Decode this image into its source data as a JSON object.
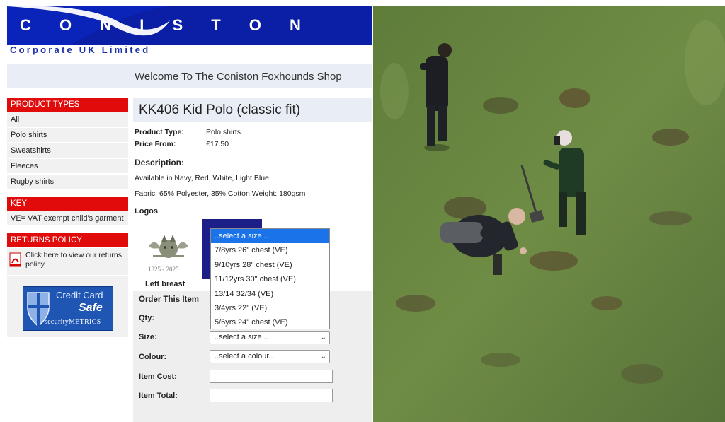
{
  "header": {
    "brand": "C O N I S T O N",
    "tagline": "Corporate UK Limited",
    "welcome": "Welcome To The Coniston Foxhounds Shop"
  },
  "sidebar": {
    "product_types_heading": "PRODUCT TYPES",
    "product_types": [
      "All",
      "Polo shirts",
      "Sweatshirts",
      "Fleeces",
      "Rugby shirts"
    ],
    "key_heading": "KEY",
    "key_text": "VE= VAT exempt child's garment",
    "returns_heading": "RETURNS POLICY",
    "returns_link": "Click here to view our returns policy",
    "credit_card": {
      "line1": "Credit Card",
      "line2": "Safe",
      "line3": "securityMETRICS"
    }
  },
  "product": {
    "title": "KK406 Kid Polo (classic fit)",
    "type_label": "Product Type:",
    "type_value": "Polo shirts",
    "price_label": "Price From:",
    "price_value": "£17.50",
    "description_heading": "Description:",
    "description_line1": "Available in Navy, Red, White, Light Blue",
    "description_line2": "Fabric: 65% Polyester, 35% Cotton Weight: 180gsm",
    "logos_heading": "Logos",
    "logo_years": "1825 - 2025",
    "logo_caption": "Left breast"
  },
  "order": {
    "heading": "Order This Item",
    "qty_label": "Qty:",
    "size_label": "Size:",
    "size_value": "..select a size ..",
    "colour_label": "Colour:",
    "colour_value": "..select a colour..",
    "item_cost_label": "Item Cost:",
    "item_total_label": "Item Total:"
  },
  "size_dropdown": {
    "options": [
      "..select a size ..",
      "7/8yrs 26\" chest (VE)",
      "9/10yrs 28\" chest (VE)",
      "11/12yrs 30\" chest (VE)",
      "13/14 32/34 (VE)",
      "3/4yrs 22\" (VE)",
      "5/6yrs 24\" chest (VE)"
    ],
    "selected_index": 0
  },
  "colors": {
    "header_blue": "#0a23b8",
    "section_red": "#e10b0b",
    "navy_swatch": "#1b1f87",
    "highlight": "#1a73e8"
  }
}
